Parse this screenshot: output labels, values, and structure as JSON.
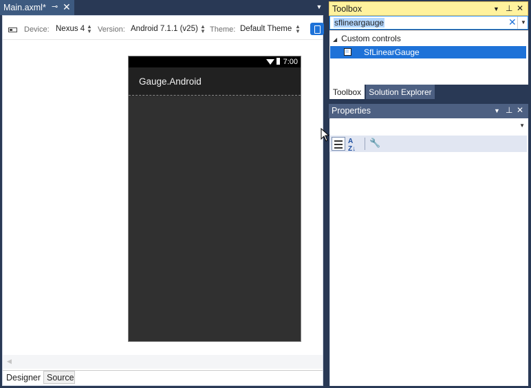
{
  "document_tab": {
    "label": "Main.axml*"
  },
  "designer_toolbar": {
    "device_label": "Device:",
    "device_value": "Nexus 4",
    "version_label": "Version:",
    "version_value": "Android 7.1.1 (v25)",
    "theme_label": "Theme:",
    "theme_value": "Default Theme"
  },
  "phone": {
    "status_time": "7:00",
    "app_title": "Gauge.Android"
  },
  "bottom_tabs": {
    "designer": "Designer",
    "source": "Source"
  },
  "toolbox": {
    "title": "Toolbox",
    "search_value": "sflineargauge",
    "group": "Custom controls",
    "item": "SfLinearGauge"
  },
  "right_tabs": {
    "toolbox": "Toolbox",
    "solution_explorer": "Solution Explorer"
  },
  "properties": {
    "title": "Properties"
  },
  "colors": {
    "accent": "#1e72d8",
    "toolbox_header": "#fff29d",
    "chrome": "#293955"
  }
}
